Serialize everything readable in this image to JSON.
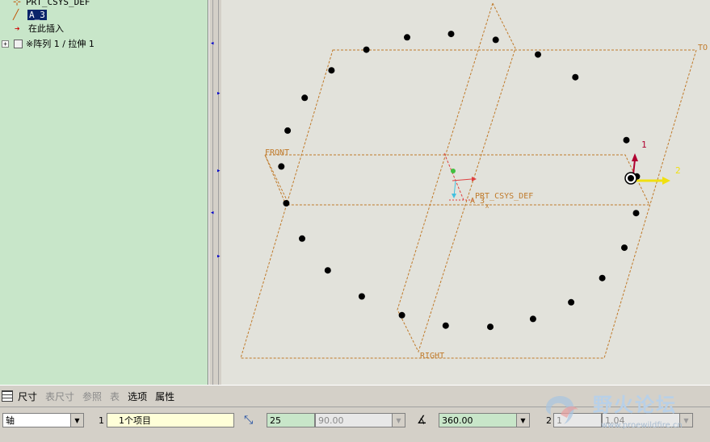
{
  "model_tree": {
    "items": [
      {
        "label": "PRT_CSYS_DEF"
      },
      {
        "label": "A_3"
      },
      {
        "label": "在此插入"
      },
      {
        "label": "※阵列 1 / 拉伸 1"
      }
    ]
  },
  "viewport": {
    "datum_labels": {
      "top": "TO",
      "front": "FRONT",
      "right": "RIGHT",
      "csys": "PRT_CSYS_DEF",
      "axis": "A_3",
      "axis_x": "X"
    },
    "handle_labels": {
      "first": "1",
      "second": "2"
    },
    "colors": {
      "datum": "#c07a2a",
      "background": "#e2e2db",
      "handle1": "#b00030",
      "handle2": "#f0e010"
    }
  },
  "tabs": [
    {
      "label": "尺寸",
      "enabled": true
    },
    {
      "label": "表尺寸",
      "enabled": false
    },
    {
      "label": "参照",
      "enabled": false
    },
    {
      "label": "表",
      "enabled": false
    },
    {
      "label": "选项",
      "enabled": true
    },
    {
      "label": "属性",
      "enabled": true
    }
  ],
  "controls": {
    "pattern_type": "轴",
    "first_dir_index": "1",
    "first_dir_items": "1个项目",
    "count": "25",
    "angle": "90.00",
    "total_angle": "360.00",
    "second_dir_index": "2",
    "second_count": "1",
    "second_value": "1.04"
  },
  "watermark": {
    "title": "野火论坛",
    "url": "www.proewildfire.cn"
  }
}
